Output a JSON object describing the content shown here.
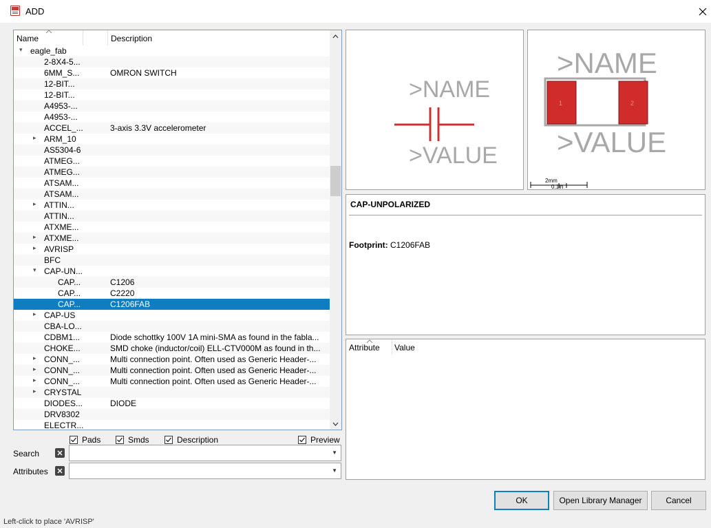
{
  "window": {
    "title": "ADD"
  },
  "tree": {
    "columns": {
      "name": "Name",
      "description": "Description"
    },
    "rows": [
      {
        "name": "eagle_fab",
        "desc": "",
        "level": 0,
        "arrow": "▾"
      },
      {
        "name": "2-8X4-5...",
        "desc": "",
        "level": 1,
        "arrow": ""
      },
      {
        "name": "6MM_S...",
        "desc": "OMRON SWITCH",
        "level": 1,
        "arrow": ""
      },
      {
        "name": "12-BIT...",
        "desc": "",
        "level": 1,
        "arrow": ""
      },
      {
        "name": "12-BIT...",
        "desc": "",
        "level": 1,
        "arrow": ""
      },
      {
        "name": "A4953-...",
        "desc": "",
        "level": 1,
        "arrow": ""
      },
      {
        "name": "A4953-...",
        "desc": "",
        "level": 1,
        "arrow": ""
      },
      {
        "name": "ACCEL_...",
        "desc": "3-axis 3.3V accelerometer",
        "level": 1,
        "arrow": ""
      },
      {
        "name": "ARM_10",
        "desc": "",
        "level": 1,
        "arrow": "▸"
      },
      {
        "name": "AS5304-6",
        "desc": "",
        "level": 1,
        "arrow": ""
      },
      {
        "name": "ATMEG...",
        "desc": "",
        "level": 1,
        "arrow": ""
      },
      {
        "name": "ATMEG...",
        "desc": "",
        "level": 1,
        "arrow": ""
      },
      {
        "name": "ATSAM...",
        "desc": "",
        "level": 1,
        "arrow": ""
      },
      {
        "name": "ATSAM...",
        "desc": "",
        "level": 1,
        "arrow": ""
      },
      {
        "name": "ATTIN...",
        "desc": "",
        "level": 1,
        "arrow": "▸"
      },
      {
        "name": "ATTIN...",
        "desc": "",
        "level": 1,
        "arrow": ""
      },
      {
        "name": "ATXME...",
        "desc": "",
        "level": 1,
        "arrow": ""
      },
      {
        "name": "ATXME...",
        "desc": "",
        "level": 1,
        "arrow": "▸"
      },
      {
        "name": "AVRISP",
        "desc": "",
        "level": 1,
        "arrow": "▸"
      },
      {
        "name": "BFC",
        "desc": "",
        "level": 1,
        "arrow": ""
      },
      {
        "name": "CAP-UN...",
        "desc": "",
        "level": 1,
        "arrow": "▾"
      },
      {
        "name": "CAP...",
        "desc": "C1206",
        "level": 2,
        "arrow": ""
      },
      {
        "name": "CAP...",
        "desc": "C2220",
        "level": 2,
        "arrow": ""
      },
      {
        "name": "CAP...",
        "desc": "C1206FAB",
        "level": 2,
        "arrow": "",
        "selected": true
      },
      {
        "name": "CAP-US",
        "desc": "",
        "level": 1,
        "arrow": "▸"
      },
      {
        "name": "CBA-LO...",
        "desc": "",
        "level": 1,
        "arrow": ""
      },
      {
        "name": "CDBM1...",
        "desc": "Diode schottky 100V 1A mini-SMA as found in the fabla...",
        "level": 1,
        "arrow": ""
      },
      {
        "name": "CHOKE...",
        "desc": "SMD choke (inductor/coil) ELL-CTV000M as found in th...",
        "level": 1,
        "arrow": ""
      },
      {
        "name": "CONN_...",
        "desc": "Multi connection point. Often used as Generic Header-...",
        "level": 1,
        "arrow": "▸"
      },
      {
        "name": "CONN_...",
        "desc": "Multi connection point. Often used as Generic Header-...",
        "level": 1,
        "arrow": "▸"
      },
      {
        "name": "CONN_...",
        "desc": "Multi connection point. Often used as Generic Header-...",
        "level": 1,
        "arrow": "▸"
      },
      {
        "name": "CRYSTAL",
        "desc": "",
        "level": 1,
        "arrow": "▸"
      },
      {
        "name": "DIODES...",
        "desc": "DIODE",
        "level": 1,
        "arrow": ""
      },
      {
        "name": "DRV8302",
        "desc": "",
        "level": 1,
        "arrow": ""
      },
      {
        "name": "ELECTR...",
        "desc": "",
        "level": 1,
        "arrow": ""
      }
    ]
  },
  "filters": {
    "pads": "Pads",
    "smds": "Smds",
    "description": "Description",
    "preview": "Preview"
  },
  "search": {
    "label": "Search",
    "value": ""
  },
  "attributes": {
    "label": "Attributes",
    "value": ""
  },
  "symbol_preview": {
    "name_text": ">NAME",
    "value_text": ">VALUE"
  },
  "package_preview": {
    "name_text": ">NAME",
    "value_text": ">VALUE",
    "scale_mm": "2mm",
    "scale_in": "0.1in",
    "pad1": "1",
    "pad2": "2"
  },
  "info": {
    "title": "CAP-UNPOLARIZED",
    "footprint_label": "Footprint:",
    "footprint_value": "C1206FAB"
  },
  "attr_table": {
    "columns": {
      "attribute": "Attribute",
      "value": "Value"
    }
  },
  "buttons": {
    "ok": "OK",
    "open_library_manager": "Open Library Manager",
    "cancel": "Cancel"
  },
  "status": {
    "text": "Left-click to place 'AVRISP'"
  },
  "colors": {
    "selection": "#0f7dc2",
    "symbol_red": "#c83232",
    "pad_red": "#d02c2c",
    "preview_gray": "#a8a8a8"
  }
}
